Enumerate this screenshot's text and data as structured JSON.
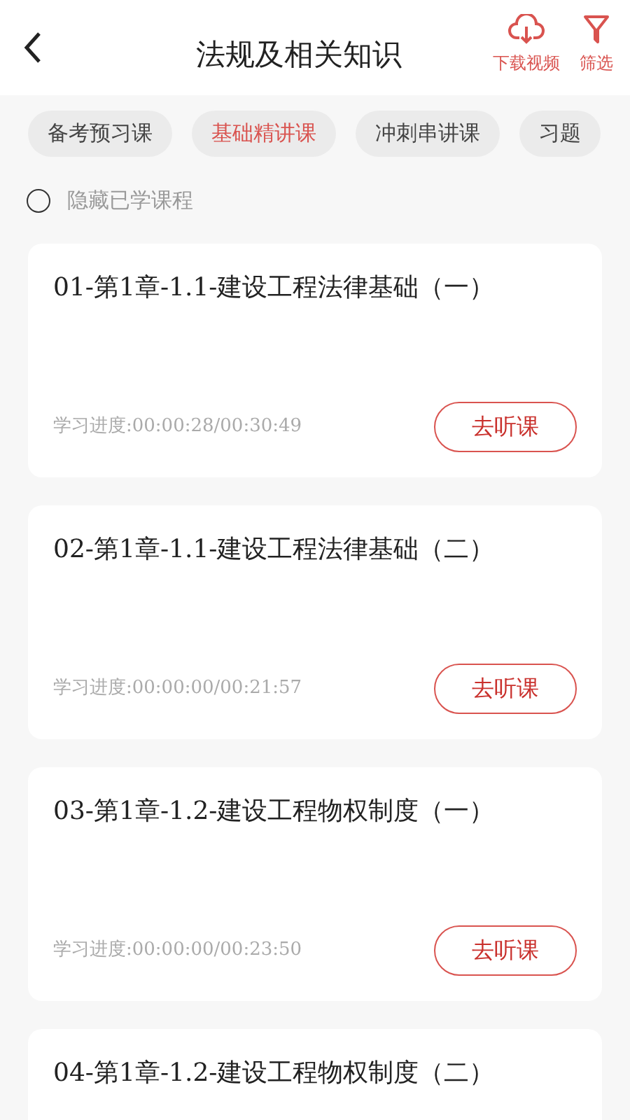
{
  "header": {
    "title": "法规及相关知识",
    "actions": [
      {
        "kind": "download",
        "label": "下载视频"
      },
      {
        "kind": "filter",
        "label": "筛选"
      }
    ]
  },
  "tabs": [
    {
      "label": "备考预习课",
      "selected": false
    },
    {
      "label": "基础精讲课",
      "selected": true
    },
    {
      "label": "冲刺串讲课",
      "selected": false
    },
    {
      "label": "习题",
      "selected": false
    }
  ],
  "hide_learned": {
    "label": "隐藏已学课程",
    "checked": false
  },
  "lessons": [
    {
      "title": "01-第1章-1.1-建设工程法律基础（一）",
      "progress": "学习进度:00:00:28/00:30:49",
      "button": "去听课"
    },
    {
      "title": "02-第1章-1.1-建设工程法律基础（二）",
      "progress": "学习进度:00:00:00/00:21:57",
      "button": "去听课"
    },
    {
      "title": "03-第1章-1.2-建设工程物权制度（一）",
      "progress": "学习进度:00:00:00/00:23:50",
      "button": "去听课"
    },
    {
      "title": "04-第1章-1.2-建设工程物权制度（二）"
    }
  ]
}
